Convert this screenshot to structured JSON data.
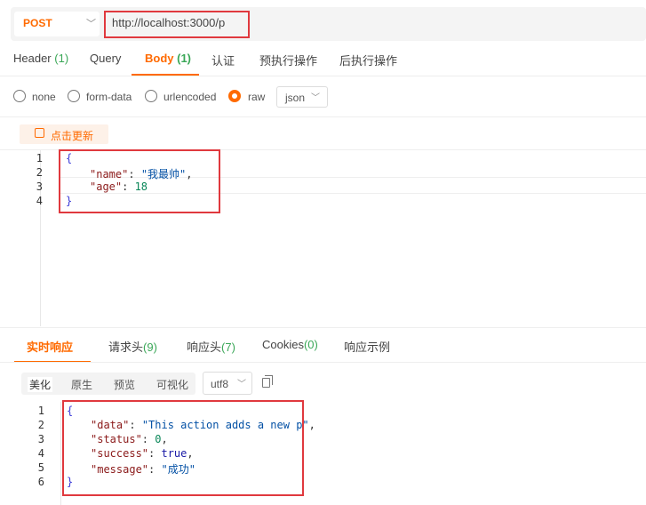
{
  "request": {
    "method": "POST",
    "url": "http://localhost:3000/p",
    "tabs": [
      {
        "label": "Header",
        "count": "(1)"
      },
      {
        "label": "Query",
        "count": ""
      },
      {
        "label": "Body",
        "count": "(1)"
      },
      {
        "label": "认证",
        "count": ""
      },
      {
        "label": "预执行操作",
        "count": ""
      },
      {
        "label": "后执行操作",
        "count": ""
      }
    ],
    "active_tab": "Body",
    "body_types": [
      "none",
      "form-data",
      "urlencoded",
      "raw"
    ],
    "selected_body_type": "raw",
    "raw_format": "json",
    "update_button": "点击更新",
    "body_lines": [
      "1",
      "2",
      "3",
      "4"
    ],
    "body_code": {
      "open": "{",
      "name_key": "\"name\"",
      "name_value": "\"我最帅\"",
      "age_key": "\"age\"",
      "age_value": "18",
      "close": "}"
    }
  },
  "response": {
    "tabs": [
      {
        "label": "实时响应",
        "count": ""
      },
      {
        "label": "请求头",
        "count": "(9)"
      },
      {
        "label": "响应头",
        "count": "(7)"
      },
      {
        "label": "Cookies",
        "count": "(0)"
      },
      {
        "label": "响应示例",
        "count": ""
      }
    ],
    "active_tab": "实时响应",
    "formats": [
      "美化",
      "原生",
      "预览",
      "可视化"
    ],
    "active_format": "美化",
    "encoding": "utf8",
    "lines": [
      "1",
      "2",
      "3",
      "4",
      "5",
      "6"
    ],
    "code": {
      "open": "{",
      "data_key": "\"data\"",
      "data_value": "\"This action adds a new p\"",
      "status_key": "\"status\"",
      "status_value": "0",
      "success_key": "\"success\"",
      "success_value": "true",
      "message_key": "\"message\"",
      "message_value": "\"成功\"",
      "close": "}"
    }
  },
  "icons": {
    "chevron": "chevron-down-icon",
    "update": "edit-icon",
    "copy": "copy-icon"
  },
  "colors": {
    "accent": "#ff6a00",
    "count_green": "#3aa757",
    "highlight_red": "#e0393e"
  }
}
